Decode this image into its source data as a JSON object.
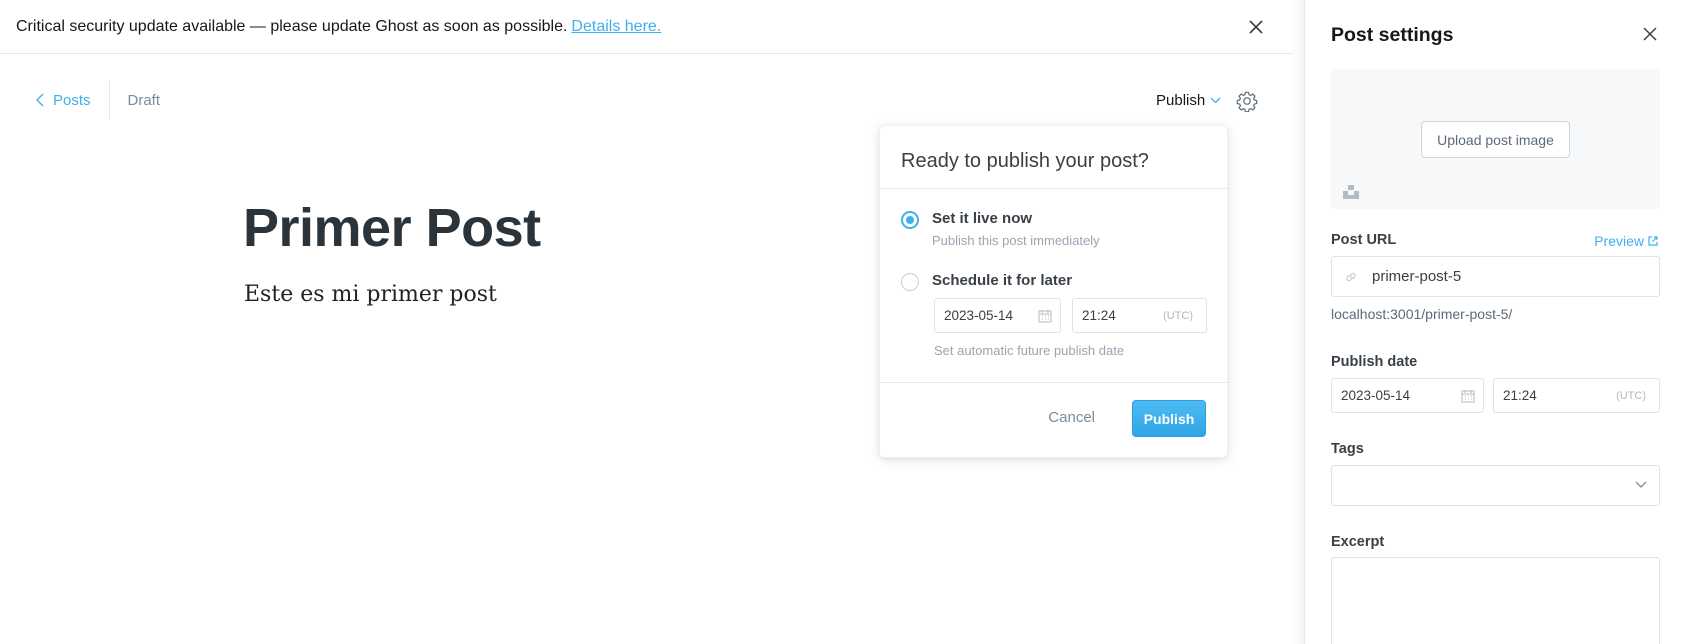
{
  "banner": {
    "message": "Critical security update available — please update Ghost as soon as possible.",
    "link_text": "Details here."
  },
  "breadcrumb": {
    "back_label": "Posts",
    "status": "Draft"
  },
  "toolbar": {
    "publish_label": "Publish"
  },
  "post": {
    "title": "Primer Post",
    "body": "Este es mi primer post"
  },
  "publish_menu": {
    "heading": "Ready to publish your post?",
    "options": [
      {
        "label": "Set it live now",
        "description": "Publish this post immediately",
        "selected": true
      },
      {
        "label": "Schedule it for later",
        "description": "Set automatic future publish date",
        "selected": false
      }
    ],
    "date": "2023-05-14",
    "time": "21:24",
    "timezone": "(UTC)",
    "cancel_label": "Cancel",
    "publish_label": "Publish"
  },
  "settings": {
    "title": "Post settings",
    "upload_label": "Upload post image",
    "post_url_label": "Post URL",
    "preview_label": "Preview",
    "slug": "primer-post-5",
    "full_url": "localhost:3001/primer-post-5/",
    "publish_date_label": "Publish date",
    "date": "2023-05-14",
    "time": "21:24",
    "timezone": "(UTC)",
    "tags_label": "Tags",
    "excerpt_label": "Excerpt"
  },
  "colors": {
    "accent": "#3eb0ef",
    "text": "#394047",
    "muted": "#9aa5b1",
    "border": "#dfe3e7"
  }
}
